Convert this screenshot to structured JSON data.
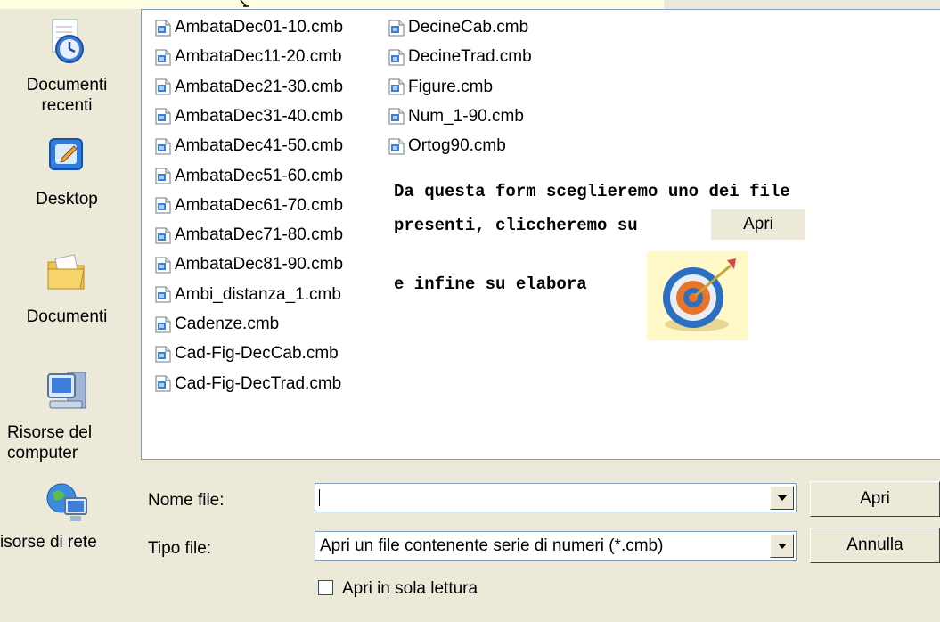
{
  "places": [
    {
      "label": "Documenti\nrecenti",
      "icon": "recent-documents-icon"
    },
    {
      "label": "Desktop",
      "icon": "desktop-icon"
    },
    {
      "label": "Documenti",
      "icon": "documents-folder-icon"
    },
    {
      "label": "Risorse del\ncomputer",
      "icon": "my-computer-icon"
    },
    {
      "label": "isorse di rete",
      "icon": "network-icon"
    }
  ],
  "files_col1": [
    "AmbataDec01-10.cmb",
    "AmbataDec11-20.cmb",
    "AmbataDec21-30.cmb",
    "AmbataDec31-40.cmb",
    "AmbataDec41-50.cmb",
    "AmbataDec51-60.cmb",
    "AmbataDec61-70.cmb",
    "AmbataDec71-80.cmb",
    "AmbataDec81-90.cmb",
    "Ambi_distanza_1.cmb",
    "Cadenze.cmb",
    "Cad-Fig-DecCab.cmb",
    "Cad-Fig-DecTrad.cmb"
  ],
  "files_col2": [
    "DecineCab.cmb",
    "DecineTrad.cmb",
    "Figure.cmb",
    "Num_1-90.cmb",
    "Ortog90.cmb"
  ],
  "annotation": {
    "line1": "Da questa form sceglieremo uno dei file",
    "line2": "presenti, cliccheremo su",
    "apri_label": "Apri",
    "line3": "e infine su elabora"
  },
  "form": {
    "filename_label": "Nome file:",
    "filename_value": "",
    "filetype_label": "Tipo file:",
    "filetype_value": "Apri un file contenente serie di numeri (*.cmb)",
    "open_button": "Apri",
    "cancel_button": "Annulla",
    "readonly_label": "Apri in sola lettura"
  }
}
